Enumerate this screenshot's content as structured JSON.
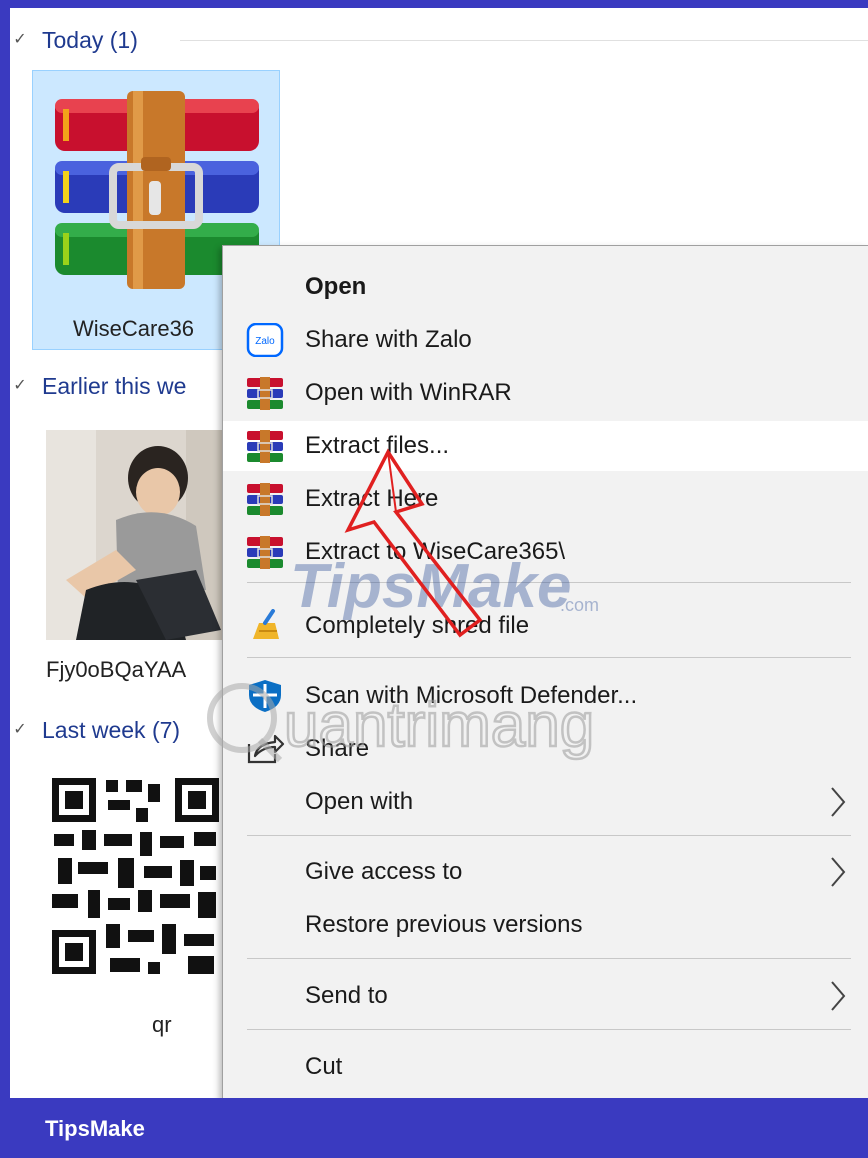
{
  "groups": {
    "today": "Today (1)",
    "earlier": "Earlier this we",
    "last_week": "Last week (7)"
  },
  "files": {
    "winrar": "WiseCare36",
    "photo": "Fjy0oBQaYAA",
    "qr": "qr"
  },
  "menu": {
    "open": "Open",
    "share_zalo": "Share with Zalo",
    "open_winrar": "Open with WinRAR",
    "extract_files": "Extract files...",
    "extract_here": "Extract Here",
    "extract_to": "Extract to WiseCare365\\",
    "shred": "Completely shred file",
    "defender": "Scan with Microsoft Defender...",
    "share": "Share",
    "open_with": "Open with",
    "give_access": "Give access to",
    "restore": "Restore previous versions",
    "send_to": "Send to",
    "cut": "Cut"
  },
  "icons": {
    "zalo_text": "Zalo"
  },
  "watermarks": {
    "tipsmake": "TipsMake",
    "tipsmake_suffix": ".com",
    "quantrimang": "uantrimang"
  },
  "footer": {
    "brand": "TipsMake"
  },
  "colors": {
    "frame": "#3a3ac0",
    "selection": "#cce8ff",
    "menu_bg": "#f2f2f2",
    "annotation_arrow": "#e02020"
  }
}
